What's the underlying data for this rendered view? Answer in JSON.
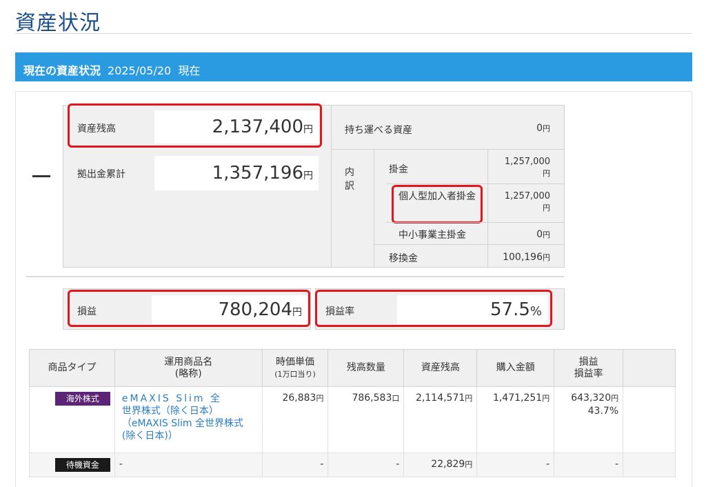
{
  "page": {
    "title": "資産状況"
  },
  "section": {
    "label": "現在の資産状況",
    "date": "2025/05/20",
    "suffix": "現在"
  },
  "summary": {
    "balance_label": "資産残高",
    "balance_value": "2,137,400",
    "yen": "円",
    "contrib_label": "拠出金累計",
    "contrib_value": "1,357,196",
    "portable_label": "持ち運べる資産",
    "portable_value": "0",
    "portable_unit": "円",
    "breakdown_label": "内訳",
    "kakekin_label": "掛金",
    "kakekin_value": "1,257,000",
    "kakekin_unit": "円",
    "personal_label": "個人型加入者掛金",
    "personal_value": "1,257,000",
    "personal_unit": "円",
    "sme_label": "中小事業主掛金",
    "sme_value": "0",
    "sme_unit": "円",
    "transfer_label": "移換金",
    "transfer_value": "100,196",
    "transfer_unit": "円"
  },
  "pl": {
    "label": "損益",
    "value": "780,204",
    "unit": "円",
    "rate_label": "損益率",
    "rate_value": "57.5",
    "rate_unit": "%"
  },
  "table": {
    "headers": {
      "type": "商品タイプ",
      "name_l1": "運用商品名",
      "name_l2": "(略称)",
      "price_l1": "時価単価",
      "price_l2": "(1万口当り)",
      "units": "残高数量",
      "balance": "資産残高",
      "purchase": "購入金額",
      "pl_l1": "損益",
      "pl_l2": "損益率"
    },
    "rows": [
      {
        "type": "海外株式",
        "name_l1": "eMAXIS Slim 全",
        "name_l2": "世界株式（除く日本）",
        "name_l3": "（eMAXIS Slim 全世界株式",
        "name_l4": "(除く日本)）",
        "price": "26,883",
        "price_unit": "円",
        "units": "786,583",
        "units_unit": "口",
        "balance": "2,114,571",
        "balance_unit": "円",
        "purchase": "1,471,251",
        "purchase_unit": "円",
        "pl": "643,320",
        "pl_unit": "円",
        "pl_rate": "43.7%"
      },
      {
        "type": "待機資金",
        "name": "-",
        "price": "-",
        "units": "-",
        "balance": "22,829",
        "balance_unit": "円",
        "purchase": "-",
        "pl": "-"
      }
    ]
  },
  "colors": {
    "accent": "#2a9ae1",
    "title": "#1a4e8a",
    "highlight": "#e0161c",
    "foreign_tag": "#5b2475",
    "cash_tag": "#1a1a1a",
    "link": "#2a7dc4"
  }
}
